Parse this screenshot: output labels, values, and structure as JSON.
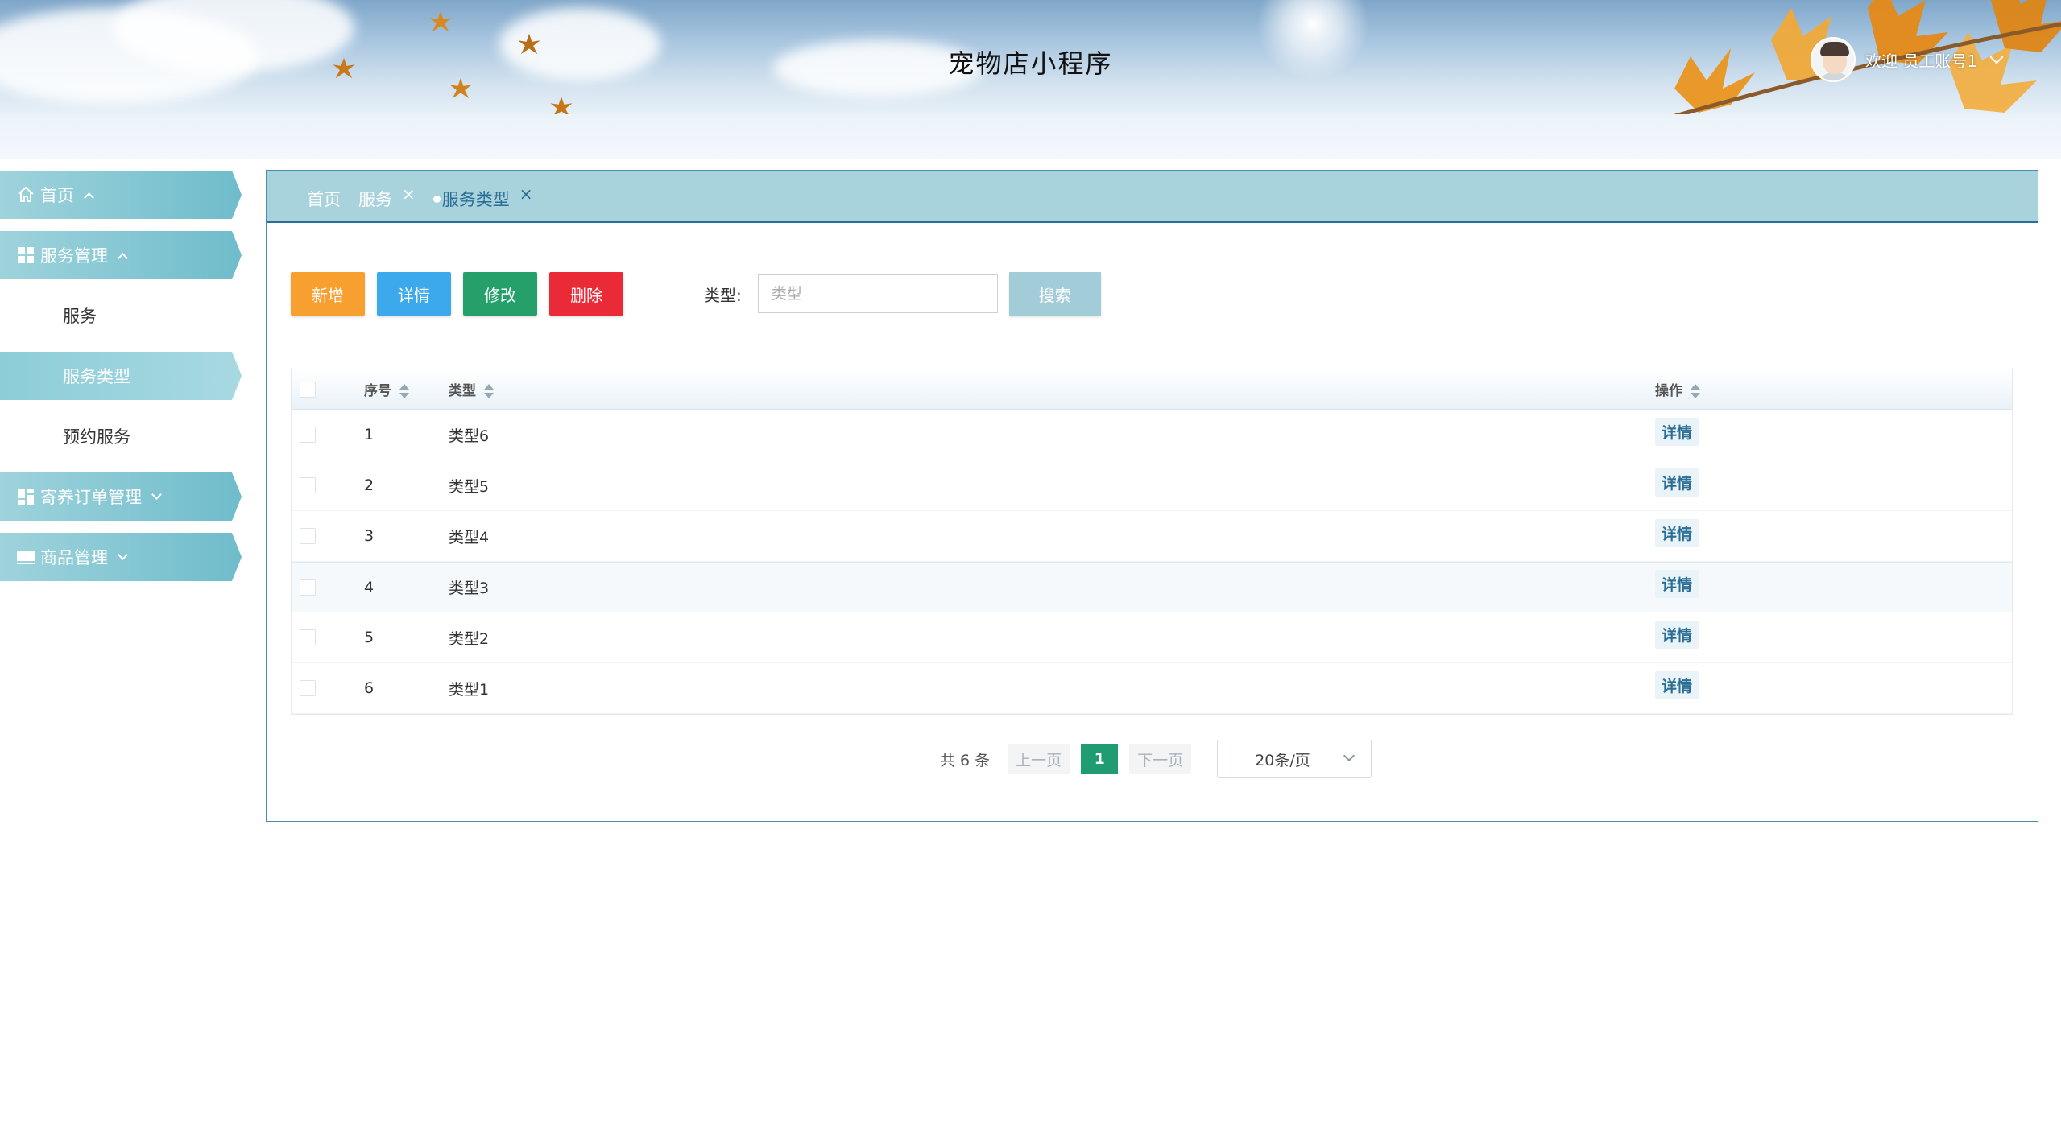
{
  "header": {
    "title": "宠物店小程序",
    "user_welcome": "欢迎 员工账号1"
  },
  "sidebar": {
    "items": [
      {
        "label": "首页",
        "icon": "home-icon",
        "expanded": true
      },
      {
        "label": "服务管理",
        "icon": "grid-icon",
        "expanded": true,
        "children": [
          {
            "label": "服务",
            "active": false
          },
          {
            "label": "服务类型",
            "active": true
          },
          {
            "label": "预约服务",
            "active": false
          }
        ]
      },
      {
        "label": "寄养订单管理",
        "icon": "dashboard-icon",
        "expanded": false
      },
      {
        "label": "商品管理",
        "icon": "monitor-icon",
        "expanded": false
      }
    ]
  },
  "tabs": [
    {
      "label": "首页",
      "closable": false,
      "active": false
    },
    {
      "label": "服务",
      "closable": true,
      "active": false
    },
    {
      "label": "服务类型",
      "closable": true,
      "active": true
    }
  ],
  "toolbar": {
    "add": "新增",
    "detail": "详情",
    "edit": "修改",
    "delete": "删除",
    "search_label": "类型:",
    "search_placeholder": "类型",
    "search_value": "",
    "search_button": "搜索"
  },
  "table": {
    "columns": {
      "index": "序号",
      "type": "类型",
      "action": "操作"
    },
    "rows": [
      {
        "index": "1",
        "type": "类型6",
        "action": "详情"
      },
      {
        "index": "2",
        "type": "类型5",
        "action": "详情"
      },
      {
        "index": "3",
        "type": "类型4",
        "action": "详情"
      },
      {
        "index": "4",
        "type": "类型3",
        "action": "详情"
      },
      {
        "index": "5",
        "type": "类型2",
        "action": "详情"
      },
      {
        "index": "6",
        "type": "类型1",
        "action": "详情"
      }
    ],
    "highlighted_row": 3
  },
  "pagination": {
    "total_text": "共 6 条",
    "prev": "上一页",
    "current_page": "1",
    "next": "下一页",
    "page_size": "20条/页"
  },
  "colors": {
    "accent": "#2b6e95",
    "sidebar": "#6fbccb",
    "btn_add": "#f7a030",
    "btn_detail": "#3ba9ec",
    "btn_edit": "#25a06b",
    "btn_delete": "#eb2a38",
    "page_active": "#1f9c72"
  }
}
